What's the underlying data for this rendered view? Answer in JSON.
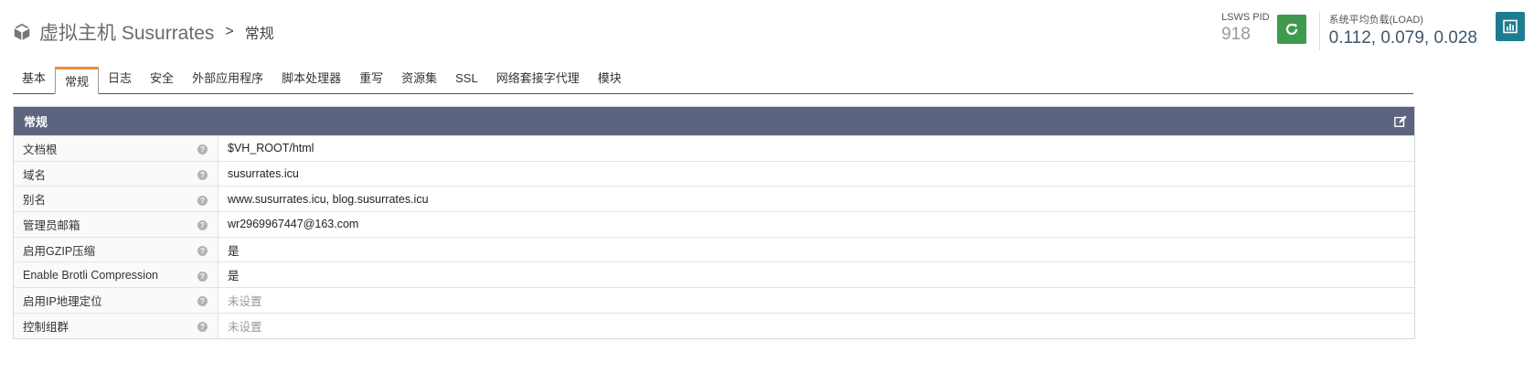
{
  "header": {
    "title_main": "虚拟主机 Susurrates",
    "separator": ">",
    "title_sub": "常规",
    "icon": "cube-icon"
  },
  "status": {
    "pid_label": "LSWS PID",
    "pid_value": "918",
    "load_label": "系统平均负载(LOAD)",
    "load_value": "0.112, 0.079, 0.028",
    "restart_icon": "refresh-icon",
    "stats_icon": "bar-chart-icon"
  },
  "tabs": [
    {
      "label": "基本"
    },
    {
      "label": "常规"
    },
    {
      "label": "日志"
    },
    {
      "label": "安全"
    },
    {
      "label": "外部应用程序"
    },
    {
      "label": "脚本处理器"
    },
    {
      "label": "重写"
    },
    {
      "label": "资源集"
    },
    {
      "label": "SSL"
    },
    {
      "label": "网络套接字代理"
    },
    {
      "label": "模块"
    }
  ],
  "active_tab": "常规",
  "panel": {
    "title": "常规",
    "help_glyph": "?",
    "rows": [
      {
        "label": "文档根",
        "value": "$VH_ROOT/html"
      },
      {
        "label": "域名",
        "value": "susurrates.icu"
      },
      {
        "label": "别名",
        "value": "www.susurrates.icu, blog.susurrates.icu"
      },
      {
        "label": "管理员邮箱",
        "value": "wr2969967447@163.com"
      },
      {
        "label": "启用GZIP压缩",
        "value": "是"
      },
      {
        "label": "Enable Brotli Compression",
        "value": "是"
      },
      {
        "label": "启用IP地理定位",
        "value": "未设置"
      },
      {
        "label": "控制组群",
        "value": "未设置"
      }
    ]
  },
  "colors": {
    "accent_tab": "#e8923a",
    "panel_header": "#5d6480",
    "restart_button": "#3f9a4f",
    "stats_button": "#1d7c8f"
  }
}
